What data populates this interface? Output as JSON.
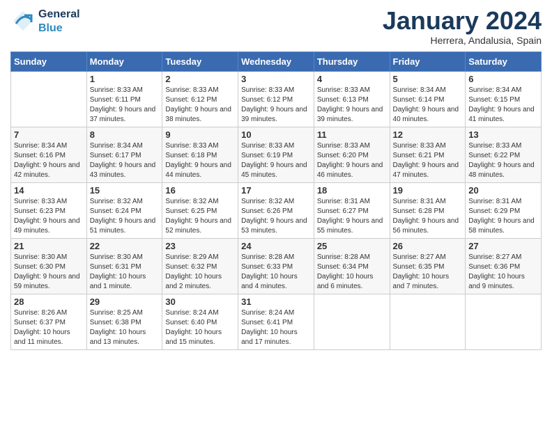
{
  "logo": {
    "general": "General",
    "blue": "Blue"
  },
  "title": "January 2024",
  "subtitle": "Herrera, Andalusia, Spain",
  "days_of_week": [
    "Sunday",
    "Monday",
    "Tuesday",
    "Wednesday",
    "Thursday",
    "Friday",
    "Saturday"
  ],
  "weeks": [
    [
      {
        "day": "",
        "info": ""
      },
      {
        "day": "1",
        "info": "Sunrise: 8:33 AM\nSunset: 6:11 PM\nDaylight: 9 hours and 37 minutes."
      },
      {
        "day": "2",
        "info": "Sunrise: 8:33 AM\nSunset: 6:12 PM\nDaylight: 9 hours and 38 minutes."
      },
      {
        "day": "3",
        "info": "Sunrise: 8:33 AM\nSunset: 6:12 PM\nDaylight: 9 hours and 39 minutes."
      },
      {
        "day": "4",
        "info": "Sunrise: 8:33 AM\nSunset: 6:13 PM\nDaylight: 9 hours and 39 minutes."
      },
      {
        "day": "5",
        "info": "Sunrise: 8:34 AM\nSunset: 6:14 PM\nDaylight: 9 hours and 40 minutes."
      },
      {
        "day": "6",
        "info": "Sunrise: 8:34 AM\nSunset: 6:15 PM\nDaylight: 9 hours and 41 minutes."
      }
    ],
    [
      {
        "day": "7",
        "info": "Sunrise: 8:34 AM\nSunset: 6:16 PM\nDaylight: 9 hours and 42 minutes."
      },
      {
        "day": "8",
        "info": "Sunrise: 8:34 AM\nSunset: 6:17 PM\nDaylight: 9 hours and 43 minutes."
      },
      {
        "day": "9",
        "info": "Sunrise: 8:33 AM\nSunset: 6:18 PM\nDaylight: 9 hours and 44 minutes."
      },
      {
        "day": "10",
        "info": "Sunrise: 8:33 AM\nSunset: 6:19 PM\nDaylight: 9 hours and 45 minutes."
      },
      {
        "day": "11",
        "info": "Sunrise: 8:33 AM\nSunset: 6:20 PM\nDaylight: 9 hours and 46 minutes."
      },
      {
        "day": "12",
        "info": "Sunrise: 8:33 AM\nSunset: 6:21 PM\nDaylight: 9 hours and 47 minutes."
      },
      {
        "day": "13",
        "info": "Sunrise: 8:33 AM\nSunset: 6:22 PM\nDaylight: 9 hours and 48 minutes."
      }
    ],
    [
      {
        "day": "14",
        "info": "Sunrise: 8:33 AM\nSunset: 6:23 PM\nDaylight: 9 hours and 49 minutes."
      },
      {
        "day": "15",
        "info": "Sunrise: 8:32 AM\nSunset: 6:24 PM\nDaylight: 9 hours and 51 minutes."
      },
      {
        "day": "16",
        "info": "Sunrise: 8:32 AM\nSunset: 6:25 PM\nDaylight: 9 hours and 52 minutes."
      },
      {
        "day": "17",
        "info": "Sunrise: 8:32 AM\nSunset: 6:26 PM\nDaylight: 9 hours and 53 minutes."
      },
      {
        "day": "18",
        "info": "Sunrise: 8:31 AM\nSunset: 6:27 PM\nDaylight: 9 hours and 55 minutes."
      },
      {
        "day": "19",
        "info": "Sunrise: 8:31 AM\nSunset: 6:28 PM\nDaylight: 9 hours and 56 minutes."
      },
      {
        "day": "20",
        "info": "Sunrise: 8:31 AM\nSunset: 6:29 PM\nDaylight: 9 hours and 58 minutes."
      }
    ],
    [
      {
        "day": "21",
        "info": "Sunrise: 8:30 AM\nSunset: 6:30 PM\nDaylight: 9 hours and 59 minutes."
      },
      {
        "day": "22",
        "info": "Sunrise: 8:30 AM\nSunset: 6:31 PM\nDaylight: 10 hours and 1 minute."
      },
      {
        "day": "23",
        "info": "Sunrise: 8:29 AM\nSunset: 6:32 PM\nDaylight: 10 hours and 2 minutes."
      },
      {
        "day": "24",
        "info": "Sunrise: 8:28 AM\nSunset: 6:33 PM\nDaylight: 10 hours and 4 minutes."
      },
      {
        "day": "25",
        "info": "Sunrise: 8:28 AM\nSunset: 6:34 PM\nDaylight: 10 hours and 6 minutes."
      },
      {
        "day": "26",
        "info": "Sunrise: 8:27 AM\nSunset: 6:35 PM\nDaylight: 10 hours and 7 minutes."
      },
      {
        "day": "27",
        "info": "Sunrise: 8:27 AM\nSunset: 6:36 PM\nDaylight: 10 hours and 9 minutes."
      }
    ],
    [
      {
        "day": "28",
        "info": "Sunrise: 8:26 AM\nSunset: 6:37 PM\nDaylight: 10 hours and 11 minutes."
      },
      {
        "day": "29",
        "info": "Sunrise: 8:25 AM\nSunset: 6:38 PM\nDaylight: 10 hours and 13 minutes."
      },
      {
        "day": "30",
        "info": "Sunrise: 8:24 AM\nSunset: 6:40 PM\nDaylight: 10 hours and 15 minutes."
      },
      {
        "day": "31",
        "info": "Sunrise: 8:24 AM\nSunset: 6:41 PM\nDaylight: 10 hours and 17 minutes."
      },
      {
        "day": "",
        "info": ""
      },
      {
        "day": "",
        "info": ""
      },
      {
        "day": "",
        "info": ""
      }
    ]
  ]
}
